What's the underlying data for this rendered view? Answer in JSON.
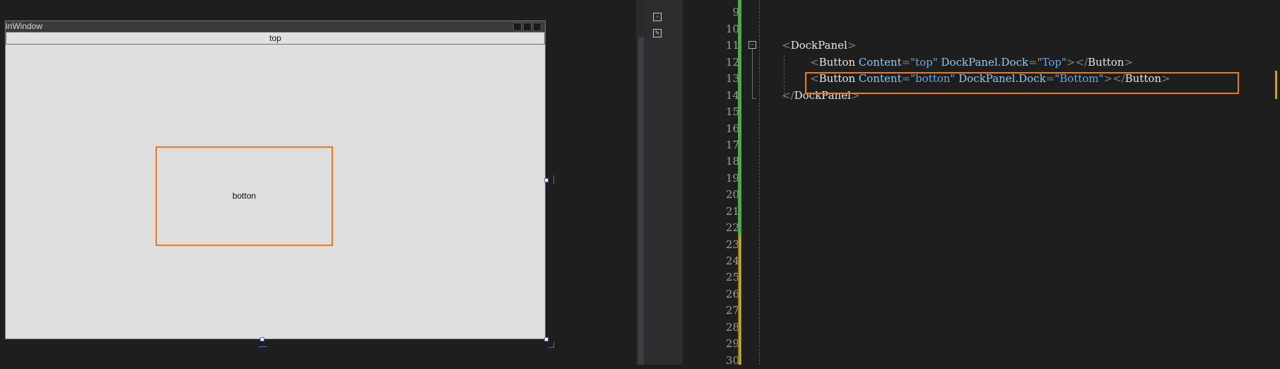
{
  "designer": {
    "window_title": "inWindow",
    "top_button_label": "top",
    "bottom_button_label": "botton"
  },
  "editor": {
    "line_numbers": [
      "9",
      "10",
      "11",
      "12",
      "13",
      "14",
      "15",
      "16",
      "17",
      "18",
      "19",
      "20",
      "21",
      "22",
      "23",
      "24",
      "25",
      "26",
      "27",
      "28",
      "29",
      "30"
    ],
    "code": {
      "line11": {
        "open": "<",
        "element": "DockPanel",
        "close": ">"
      },
      "line12": {
        "open": "<",
        "element": "Button",
        "attr1": "Content",
        "eq1": "=",
        "val1": "\"top\"",
        "attr2": "DockPanel.Dock",
        "eq2": "=",
        "val2": "\"Top\"",
        "mid": "></",
        "end_element": "Button",
        "close": ">"
      },
      "line13": {
        "open": "<",
        "element": "Button",
        "attr1": "Content",
        "eq1": "=",
        "val1": "\"botton\"",
        "attr2": "DockPanel.Dock",
        "eq2": "=",
        "val2": "\"Bottom\"",
        "mid": "></",
        "end_element": "Button",
        "close": ">"
      },
      "line14": {
        "open": "</",
        "element": "DockPanel",
        "close": ">"
      }
    },
    "fold_glyph": "−"
  },
  "icons": [
    "designer-view-icon",
    "xaml-edit-icon"
  ],
  "colors": {
    "highlight": "#f07b1c",
    "change_bar": "#57a64a",
    "window_border": "#5a7fb8"
  }
}
